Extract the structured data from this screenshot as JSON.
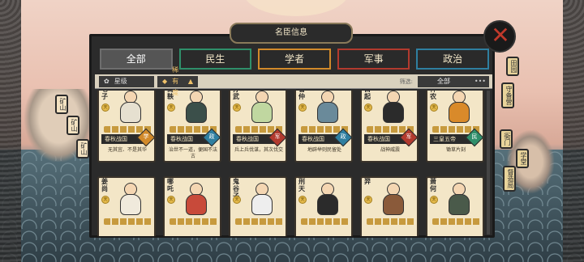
{
  "title": "名臣信息",
  "tabs": [
    {
      "label": "全部",
      "color": "#6e6e6e"
    },
    {
      "label": "民生",
      "color": "#2f8f6a"
    },
    {
      "label": "学者",
      "color": "#d28a2a"
    },
    {
      "label": "军事",
      "color": "#b23a2e"
    },
    {
      "label": "政治",
      "color": "#2f7fa0"
    }
  ],
  "filter": {
    "sort_star": "星级",
    "sort_rarity": "稀有度",
    "filter_label": "筛选:",
    "filter_value": "全部",
    "more_icon": "ellipsis-icon"
  },
  "cards": [
    {
      "name": "老子",
      "coin": "天",
      "era": "春秋战国",
      "cls": "学",
      "cls_color": "#d28a2a",
      "desc": "无其宜、不是其华",
      "body_color": "#e6e0d0"
    },
    {
      "name": "商鞅",
      "coin": "天",
      "era": "春秋战国",
      "cls": "政",
      "cls_color": "#2f7fa0",
      "desc": "治世不一道，便国不法古",
      "body_color": "#3b4f4a"
    },
    {
      "name": "孙武",
      "coin": "天",
      "era": "春秋战国",
      "cls": "军",
      "cls_color": "#b23a2e",
      "desc": "兵上兵伐谋，其次伐交",
      "body_color": "#c0d7a0"
    },
    {
      "name": "管仲",
      "coin": "天",
      "era": "春秋战国",
      "cls": "政",
      "cls_color": "#2f7fa0",
      "desc": "地辟举则民留处",
      "body_color": "#6a8a9a"
    },
    {
      "name": "白起",
      "coin": "天",
      "era": "春秋战国",
      "cls": "军",
      "cls_color": "#b23a2e",
      "desc": "战神威震",
      "body_color": "#2b2b2b"
    },
    {
      "name": "神农",
      "coin": "天",
      "era": "三皇五帝",
      "cls": "民",
      "cls_color": "#2f8f6a",
      "desc": "锄草片刻",
      "body_color": "#d98a2a"
    },
    {
      "name": "姜尚",
      "coin": "天",
      "era": "",
      "cls": "",
      "cls_color": "#2f7fa0",
      "desc": "",
      "body_color": "#f0eadc"
    },
    {
      "name": "哪吒",
      "coin": "天",
      "era": "",
      "cls": "",
      "cls_color": "#b23a2e",
      "desc": "",
      "body_color": "#c84a3a"
    },
    {
      "name": "鬼谷子",
      "coin": "天",
      "era": "",
      "cls": "",
      "cls_color": "#d28a2a",
      "desc": "",
      "body_color": "#eeeeee"
    },
    {
      "name": "刑天",
      "coin": "天",
      "era": "",
      "cls": "",
      "cls_color": "#b23a2e",
      "desc": "",
      "body_color": "#2b2b2b"
    },
    {
      "name": "羿",
      "coin": "天",
      "era": "",
      "cls": "",
      "cls_color": "#b23a2e",
      "desc": "",
      "body_color": "#8a5a3a"
    },
    {
      "name": "萧何",
      "coin": "天",
      "era": "",
      "cls": "",
      "cls_color": "#2f7fa0",
      "desc": "",
      "body_color": "#4a5a4a"
    }
  ],
  "side_tags_left": [
    "矿山",
    "矿山",
    "矿山"
  ],
  "side_tags_right": [
    "田园",
    "守备营",
    "衙门",
    "学堂",
    "督造局"
  ]
}
